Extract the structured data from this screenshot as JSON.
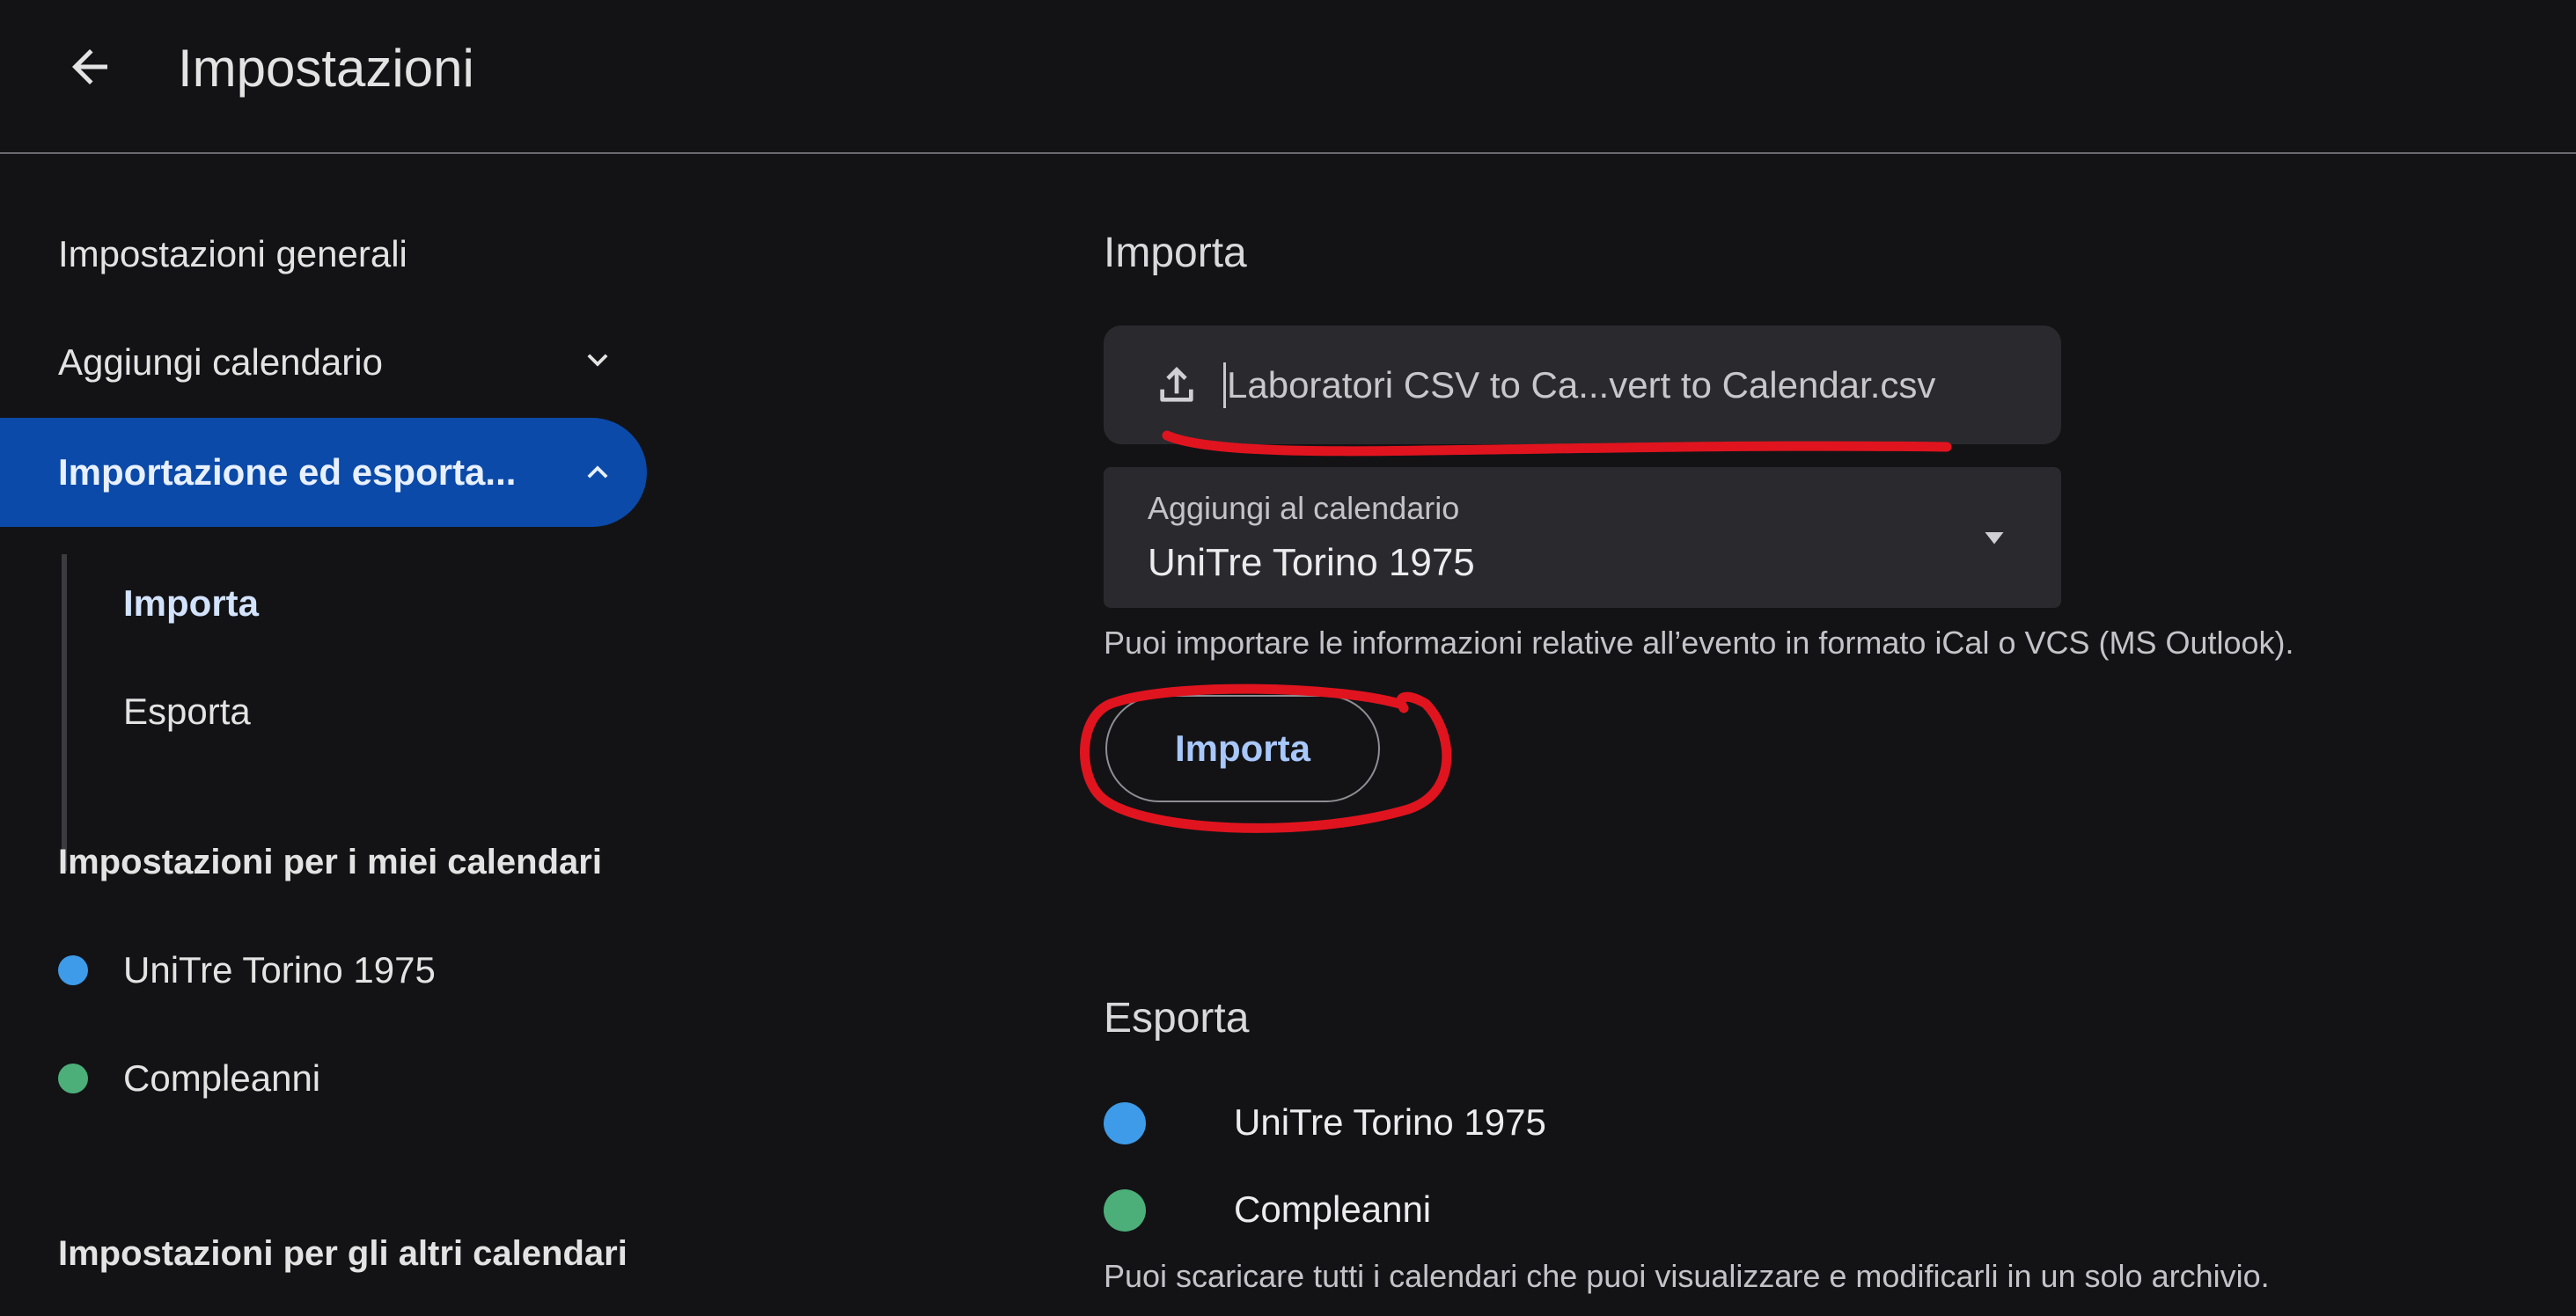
{
  "header": {
    "title": "Impostazioni",
    "back_icon": "arrow-left-icon"
  },
  "sidebar": {
    "general": "Impostazioni generali",
    "add_calendar": "Aggiungi calendario",
    "import_export": "Importazione ed esporta...",
    "sub_items": [
      "Importa",
      "Esporta"
    ],
    "my_calendars_heading": "Impostazioni per i miei calendari",
    "my_calendars": [
      {
        "name": "UniTre Torino 1975",
        "color": "#3d9be9"
      },
      {
        "name": "Compleanni",
        "color": "#4caf7a"
      }
    ],
    "other_calendars_heading": "Impostazioni per gli altri calendari"
  },
  "import": {
    "heading": "Importa",
    "file_name": "Laboratori CSV to Ca...vert to Calendar.csv",
    "select_label": "Aggiungi al calendario",
    "select_value": "UniTre Torino 1975",
    "help": "Puoi importare le informazioni relative all’evento in formato iCal o VCS (MS Outlook).",
    "button": "Importa"
  },
  "export": {
    "heading": "Esporta",
    "calendars": [
      {
        "name": "UniTre Torino 1975",
        "color": "#3d9be9"
      },
      {
        "name": "Compleanni",
        "color": "#4caf7a"
      }
    ],
    "help": "Puoi scaricare tutti i calendari che puoi visualizzare e modificarli in un solo archivio."
  },
  "colors": {
    "background": "#131316",
    "active_nav": "#0b4aa8",
    "annotation": "#e0141e",
    "button_text": "#a8c7fa"
  }
}
